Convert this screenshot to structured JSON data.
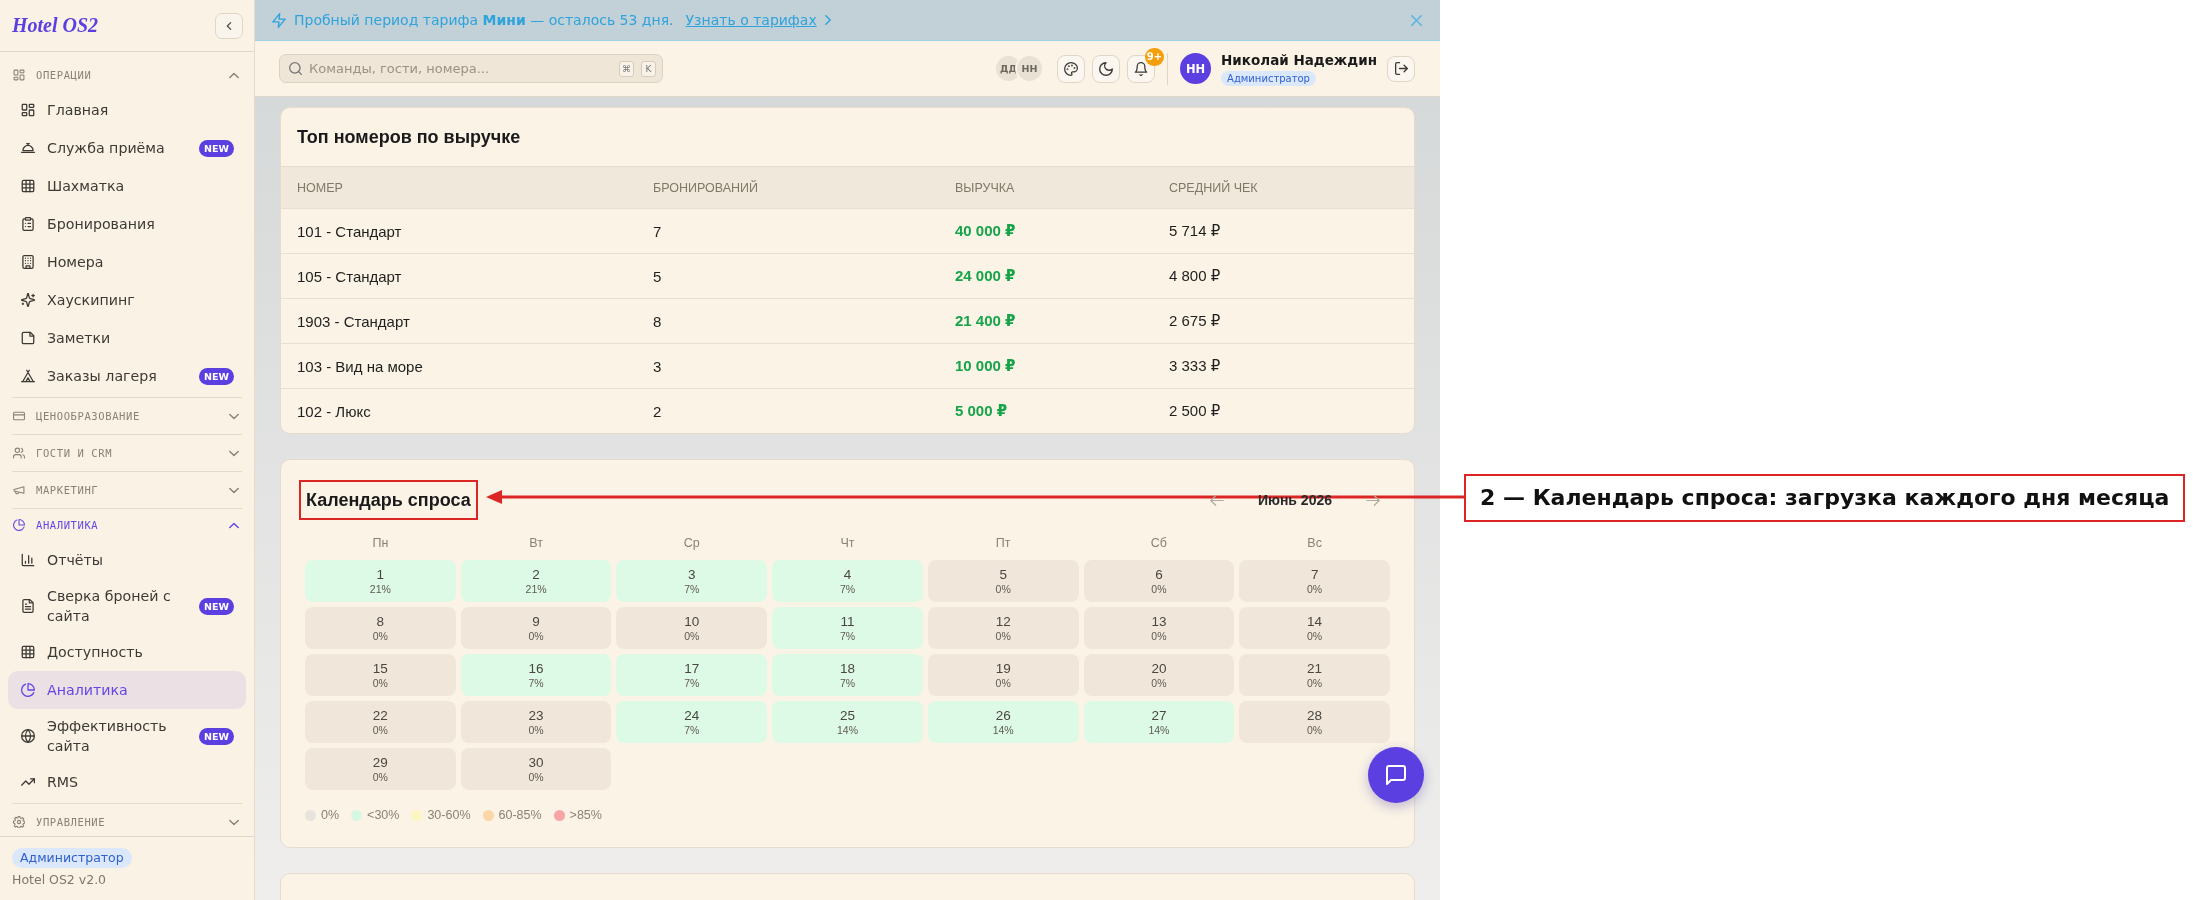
{
  "sidebar": {
    "logo": "Hotel OS2",
    "sections": [
      {
        "title": "ОПЕРАЦИИ",
        "expanded": true,
        "items": [
          {
            "label": "Главная",
            "selected": false
          },
          {
            "label": "Служба приёма",
            "badge": "NEW",
            "selected": false
          },
          {
            "label": "Шахматка",
            "selected": false
          },
          {
            "label": "Бронирования",
            "selected": false
          },
          {
            "label": "Номера",
            "selected": false
          },
          {
            "label": "Хаускипинг",
            "selected": false
          },
          {
            "label": "Заметки",
            "selected": false
          },
          {
            "label": "Заказы лагеря",
            "badge": "NEW",
            "selected": false
          }
        ]
      },
      {
        "title": "ЦЕНООБРАЗОВАНИЕ",
        "expanded": false
      },
      {
        "title": "ГОСТИ И CRM",
        "expanded": false
      },
      {
        "title": "МАРКЕТИНГ",
        "expanded": false
      },
      {
        "title": "АНАЛИТИКА",
        "expanded": true,
        "items": [
          {
            "label": "Отчёты",
            "selected": false
          },
          {
            "label": "Сверка броней с сайта",
            "badge": "NEW",
            "selected": false
          },
          {
            "label": "Доступность",
            "selected": false
          },
          {
            "label": "Аналитика",
            "selected": true
          },
          {
            "label": "Эффективность сайта",
            "badge": "NEW",
            "selected": false
          },
          {
            "label": "RMS",
            "selected": false
          }
        ]
      },
      {
        "title": "УПРАВЛЕНИЕ",
        "expanded": false
      }
    ],
    "footer": {
      "role": "Администратор",
      "version": "Hotel OS2 v2.0"
    }
  },
  "banner": {
    "text": "Пробный период тарифа **Мини** — осталось 53 дня.",
    "link": "Узнать о тарифах"
  },
  "header": {
    "search": {
      "placeholder": "Команды, гости, номера...",
      "shortcut": [
        "⌘",
        "K"
      ]
    },
    "online_users": [
      "ДД",
      "НН"
    ],
    "notifications": {
      "badge": "9+"
    },
    "user": {
      "initials": "НН",
      "name": "Николай Надеждин",
      "role": "Администратор"
    }
  },
  "revenue_table": {
    "title": "Топ номеров по выручке",
    "columns": [
      {
        "label": "НОМЕР",
        "kind": "plain"
      },
      {
        "label": "БРОНИРОВАНИЙ",
        "kind": "plain"
      },
      {
        "label": "ВЫРУЧКА",
        "kind": "accent"
      },
      {
        "label": "СРЕДНИЙ ЧЕК",
        "kind": "plain"
      }
    ],
    "rows": [
      [
        "101 - Стандарт",
        "7",
        "40 000 ₽",
        "5 714 ₽"
      ],
      [
        "105 - Стандарт",
        "5",
        "24 000 ₽",
        "4 800 ₽"
      ],
      [
        "1903 - Стандарт",
        "8",
        "21 400 ₽",
        "2 675 ₽"
      ],
      [
        "103 - Вид на море",
        "3",
        "10 000 ₽",
        "3 333 ₽"
      ],
      [
        "102 - Люкс",
        "2",
        "5 000 ₽",
        "2 500 ₽"
      ]
    ]
  },
  "demand_calendar": {
    "title": "Календарь спроса",
    "month": "Июнь 2026",
    "weekdays": [
      "Пн",
      "Вт",
      "Ср",
      "Чт",
      "Пт",
      "Сб",
      "Вс"
    ],
    "days": [
      {
        "day": "1",
        "load": "21%",
        "color": "#dcfae6"
      },
      {
        "day": "2",
        "load": "21%",
        "color": "#dcfae6"
      },
      {
        "day": "3",
        "load": "7%",
        "color": "#dcfae6"
      },
      {
        "day": "4",
        "load": "7%",
        "color": "#dcfae6"
      },
      {
        "day": "5",
        "load": "0%",
        "color": "#f0e7da"
      },
      {
        "day": "6",
        "load": "0%",
        "color": "#f0e7da"
      },
      {
        "day": "7",
        "load": "0%",
        "color": "#f0e7da"
      },
      {
        "day": "8",
        "load": "0%",
        "color": "#f0e7da"
      },
      {
        "day": "9",
        "load": "0%",
        "color": "#f0e7da"
      },
      {
        "day": "10",
        "load": "0%",
        "color": "#f0e7da"
      },
      {
        "day": "11",
        "load": "7%",
        "color": "#dcfae6"
      },
      {
        "day": "12",
        "load": "0%",
        "color": "#f0e7da"
      },
      {
        "day": "13",
        "load": "0%",
        "color": "#f0e7da"
      },
      {
        "day": "14",
        "load": "0%",
        "color": "#f0e7da"
      },
      {
        "day": "15",
        "load": "0%",
        "color": "#f0e7da"
      },
      {
        "day": "16",
        "load": "7%",
        "color": "#dcfae6"
      },
      {
        "day": "17",
        "load": "7%",
        "color": "#dcfae6"
      },
      {
        "day": "18",
        "load": "7%",
        "color": "#dcfae6"
      },
      {
        "day": "19",
        "load": "0%",
        "color": "#f0e7da"
      },
      {
        "day": "20",
        "load": "0%",
        "color": "#f0e7da"
      },
      {
        "day": "21",
        "load": "0%",
        "color": "#f0e7da"
      },
      {
        "day": "22",
        "load": "0%",
        "color": "#f0e7da"
      },
      {
        "day": "23",
        "load": "0%",
        "color": "#f0e7da"
      },
      {
        "day": "24",
        "load": "7%",
        "color": "#dcfae6"
      },
      {
        "day": "25",
        "load": "14%",
        "color": "#dcfae6"
      },
      {
        "day": "26",
        "load": "14%",
        "color": "#dcfae6"
      },
      {
        "day": "27",
        "load": "14%",
        "color": "#dcfae6"
      },
      {
        "day": "28",
        "load": "0%",
        "color": "#f0e7da"
      },
      {
        "day": "29",
        "load": "0%",
        "color": "#f0e7da"
      },
      {
        "day": "30",
        "load": "0%",
        "color": "#f0e7da"
      }
    ],
    "legend": [
      {
        "label": "0%",
        "color": "#e7e4de"
      },
      {
        "label": "<30%",
        "color": "#d6f8e2"
      },
      {
        "label": "30-60%",
        "color": "#fdf6c3"
      },
      {
        "label": "60-85%",
        "color": "#fdd6a8"
      },
      {
        "label": ">85%",
        "color": "#f8a5a5"
      }
    ]
  },
  "annotation": {
    "text": "2 — Календарь спроса: загрузка каждого дня месяца"
  }
}
